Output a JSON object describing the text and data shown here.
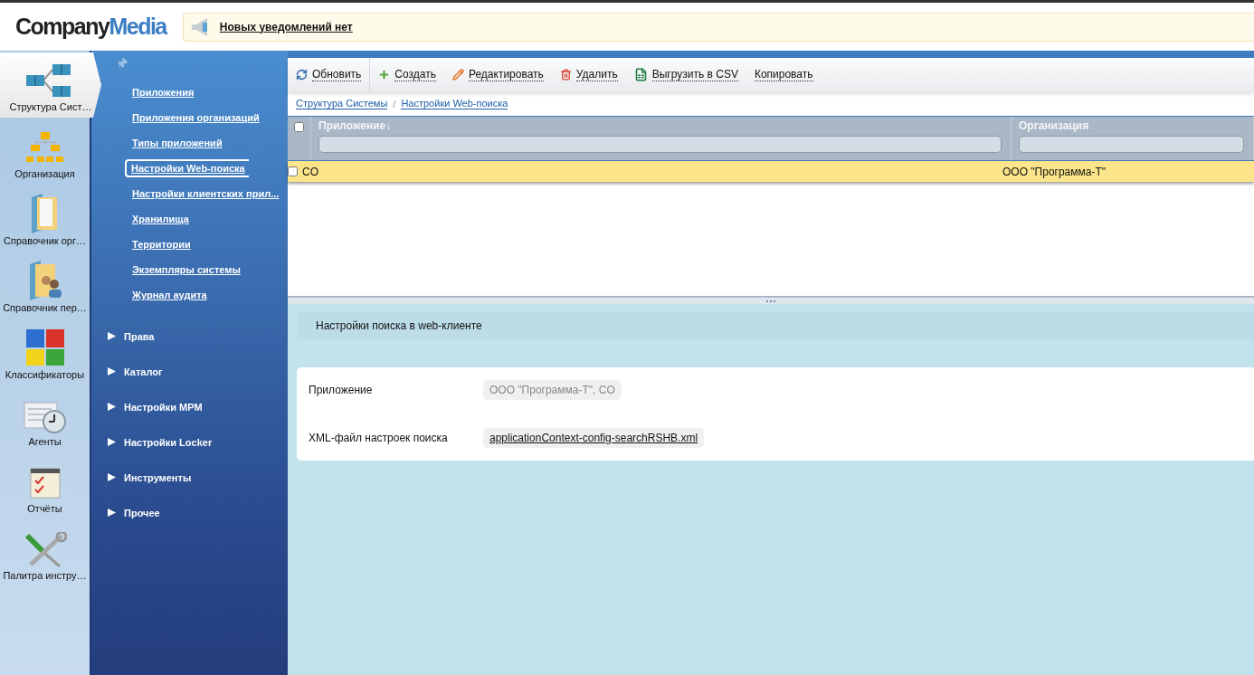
{
  "header": {
    "logo": {
      "part_1": "Company",
      "part_2": "Media"
    },
    "notification": "Новых уведомлений нет"
  },
  "modules": [
    {
      "label": "Структура Сист…",
      "kind": "structure",
      "selected": true
    },
    {
      "label": "Организация",
      "kind": "org",
      "selected": false
    },
    {
      "label": "Справочник орг…",
      "kind": "folder",
      "selected": false
    },
    {
      "label": "Справочник пер…",
      "kind": "people",
      "selected": false
    },
    {
      "label": "Классификаторы",
      "kind": "puzzle",
      "selected": false
    },
    {
      "label": "Агенты",
      "kind": "clock",
      "selected": false
    },
    {
      "label": "Отчёты",
      "kind": "report",
      "selected": false
    },
    {
      "label": "Палитра инстру…",
      "kind": "tools",
      "selected": false
    }
  ],
  "nav": {
    "links": [
      {
        "label": "Приложения",
        "selected": false
      },
      {
        "label": "Приложения организаций",
        "selected": false
      },
      {
        "label": "Типы приложений",
        "selected": false
      },
      {
        "label": "Настройки Web-поиска",
        "selected": true
      },
      {
        "label": "Настройки клиентских прил...",
        "selected": false
      },
      {
        "label": "Хранилища",
        "selected": false
      },
      {
        "label": "Территории",
        "selected": false
      },
      {
        "label": "Экземпляры системы",
        "selected": false
      },
      {
        "label": "Журнал аудита",
        "selected": false
      }
    ],
    "sections": [
      {
        "label": "Права",
        "expanded": false
      },
      {
        "label": "Каталог",
        "expanded": false
      },
      {
        "label": "Настройки MPM",
        "expanded": false
      },
      {
        "label": "Настройки Locker",
        "expanded": false
      },
      {
        "label": "Инструменты",
        "expanded": false
      },
      {
        "label": "Прочее",
        "expanded": false
      }
    ]
  },
  "toolbar": [
    {
      "label": "Обновить",
      "kind": "refresh"
    },
    {
      "label": "Создать",
      "kind": "create"
    },
    {
      "label": "Редактировать",
      "kind": "edit"
    },
    {
      "label": "Удалить",
      "kind": "delete"
    },
    {
      "label": "Выгрузить в CSV",
      "kind": "excel"
    },
    {
      "label": "Копировать",
      "kind": "plain"
    }
  ],
  "breadcrumbs": [
    "Структура Системы",
    "Настройки Web-поиска"
  ],
  "breadcrumb_separator": "/",
  "table": {
    "all_checked": false,
    "columns": [
      {
        "label": "Приложение↓"
      },
      {
        "label": "Организация"
      }
    ],
    "rows": [
      {
        "cells": [
          "CO",
          "ООО \"Программа-Т\""
        ],
        "selected": true,
        "checked": false
      }
    ]
  },
  "detail": {
    "title": "Настройки поиска в web-клиенте",
    "fields": [
      {
        "label": "Приложение",
        "value": "ООО \"Программа-Т\", CO",
        "kind": "readonly"
      },
      {
        "label": "XML-файл настроек поиска",
        "value": "applicationContext-config-searchRSHB.xml",
        "kind": "link"
      }
    ]
  }
}
